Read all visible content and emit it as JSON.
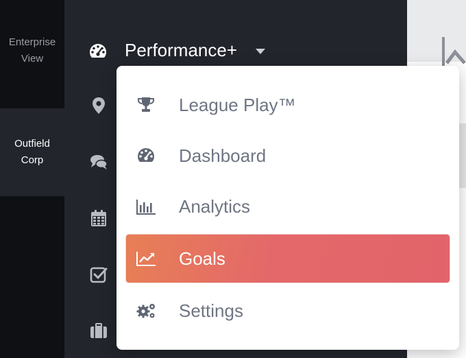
{
  "orgs": {
    "enterprise_line1": "Enterprise",
    "enterprise_line2": "View",
    "outfield_line1": "Outfield",
    "outfield_line2": "Corp"
  },
  "nav": {
    "title": "Performance+",
    "title_icon": "dashboard-gauge-icon",
    "side_icons": [
      "map-pin-icon",
      "chat-bubbles-icon",
      "calendar-icon",
      "checkbox-icon",
      "briefcase-icon"
    ]
  },
  "menu": {
    "items": [
      {
        "label": "League Play™",
        "icon": "trophy-icon",
        "active": false
      },
      {
        "label": "Dashboard",
        "icon": "dashboard-gauge-icon",
        "active": false
      },
      {
        "label": "Analytics",
        "icon": "bar-chart-icon",
        "active": false
      },
      {
        "label": "Goals",
        "icon": "trend-line-icon",
        "active": true
      },
      {
        "label": "Settings",
        "icon": "gears-icon",
        "active": false
      }
    ]
  },
  "colors": {
    "sidebar_bg": "#23252d",
    "org_rail_bg": "#0f1013",
    "active_gradient_start": "#e77f55",
    "active_gradient_end": "#e2646a",
    "menu_text": "#6f7683"
  }
}
